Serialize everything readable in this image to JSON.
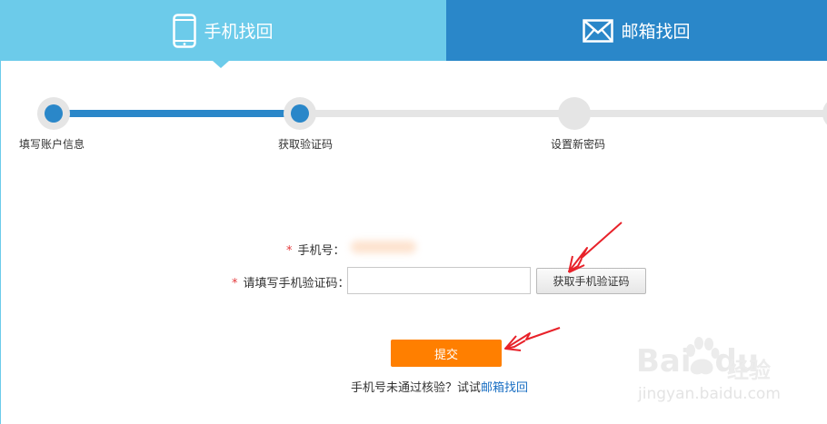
{
  "tabs": {
    "phone": {
      "label": "手机找回",
      "icon": "phone-icon"
    },
    "email": {
      "label": "邮箱找回",
      "icon": "mail-icon"
    }
  },
  "steps": [
    {
      "label": "填写账户信息",
      "done": true
    },
    {
      "label": "获取验证码",
      "done": true
    },
    {
      "label": "设置新密码",
      "done": false
    }
  ],
  "form": {
    "required_mark": "*",
    "phone_label": "手机号：",
    "code_label": "请填写手机验证码：",
    "code_value": "",
    "get_code_button": "获取手机验证码",
    "submit_button": "提交"
  },
  "footer": {
    "text": "手机号未通过核验？试试",
    "link": "邮箱找回"
  },
  "watermark": {
    "brand": "Bai",
    "brand_tail": "du",
    "brand_cn": "经验",
    "url": "jingyan.baidu.com"
  },
  "colors": {
    "tab_active": "#6ccbea",
    "tab_inactive": "#2a87c9",
    "progress": "#2a87c9",
    "submit": "#ff7f00",
    "required": "#e4393c",
    "annotation": "#e8222a"
  }
}
